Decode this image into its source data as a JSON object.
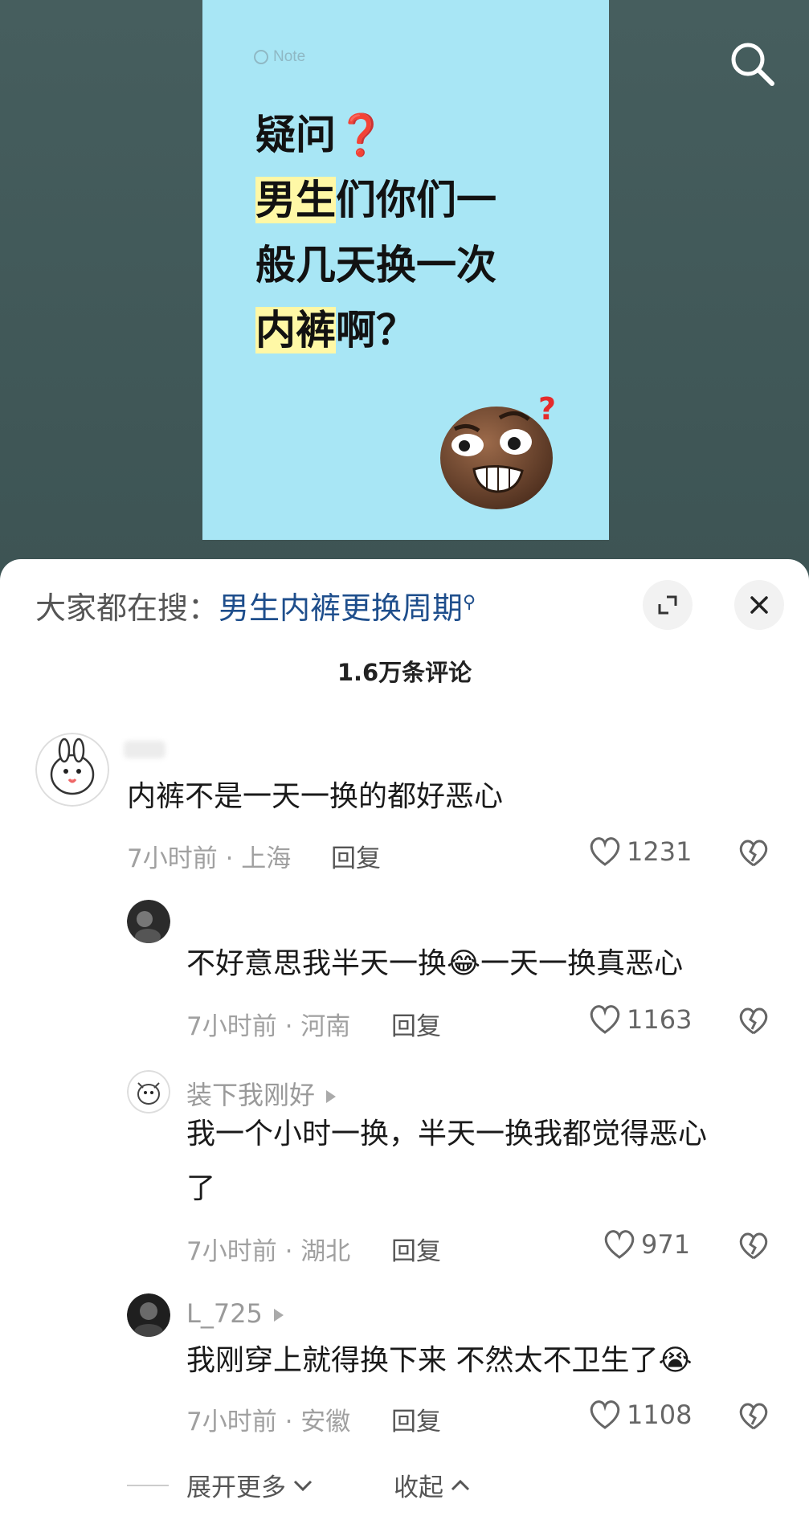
{
  "image_card": {
    "note_label": "Note",
    "line1": "疑问",
    "line2_highlight": "男生",
    "line2_rest": "们你们一",
    "line3": "般几天换一次",
    "line4_highlight": "内裤",
    "line4_rest": "啊？"
  },
  "search_bar": {
    "prefix": "大家都在搜：",
    "term": "男生内裤更换周期",
    "icon": "search-icon"
  },
  "comment_count": "1.6万条评论",
  "comments": [
    {
      "username": "",
      "text": "内裤不是一天一换的都好恶心",
      "meta": "7小时前 · 上海",
      "reply_label": "回复",
      "likes": "1231"
    },
    {
      "username": "",
      "text": "不好意思我半天一换😂一天一换真恶心",
      "meta": "7小时前 · 河南",
      "reply_label": "回复",
      "likes": "1163"
    },
    {
      "username": "装下我刚好",
      "text_line1": "我一个小时一换，半天一换我都觉得恶心",
      "text_line2": "了",
      "meta": "7小时前 · 湖北",
      "reply_label": "回复",
      "likes": "971"
    },
    {
      "username": "L_725",
      "text": "我刚穿上就得换下来 不然太不卫生了😭",
      "meta": "7小时前 · 安徽",
      "reply_label": "回复",
      "likes": "1108"
    }
  ],
  "footer": {
    "expand_label": "展开更多",
    "collapse_label": "收起"
  },
  "colors": {
    "card_bg": "#a8e6f5",
    "highlight": "#fff8a6",
    "search_term": "#1e4e8c",
    "backdrop": "#3f5656"
  }
}
